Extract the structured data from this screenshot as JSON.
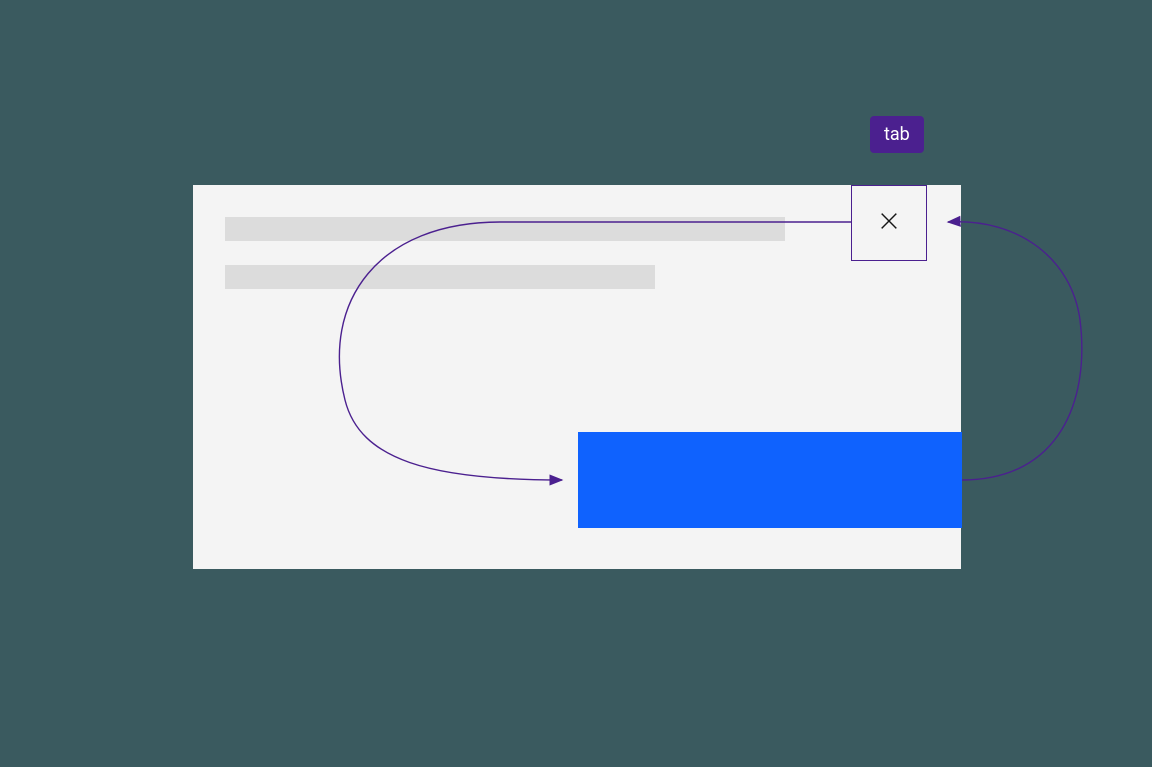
{
  "labels": {
    "tab_key": "tab"
  },
  "colors": {
    "background": "#3a5a5f",
    "panel": "#f4f4f4",
    "placeholder": "#dcdcdc",
    "primary_button": "#0f62fe",
    "accent": "#4b208f"
  },
  "diagram": {
    "description": "Keyboard focus trap loop in a modal dialog: Tab moves focus from close button to primary action, and from primary action it wraps back to the close button.",
    "flow": [
      {
        "from": "close-button",
        "to": "primary-action-button",
        "key": "tab"
      },
      {
        "from": "primary-action-button",
        "to": "close-button",
        "key": "tab"
      }
    ]
  }
}
